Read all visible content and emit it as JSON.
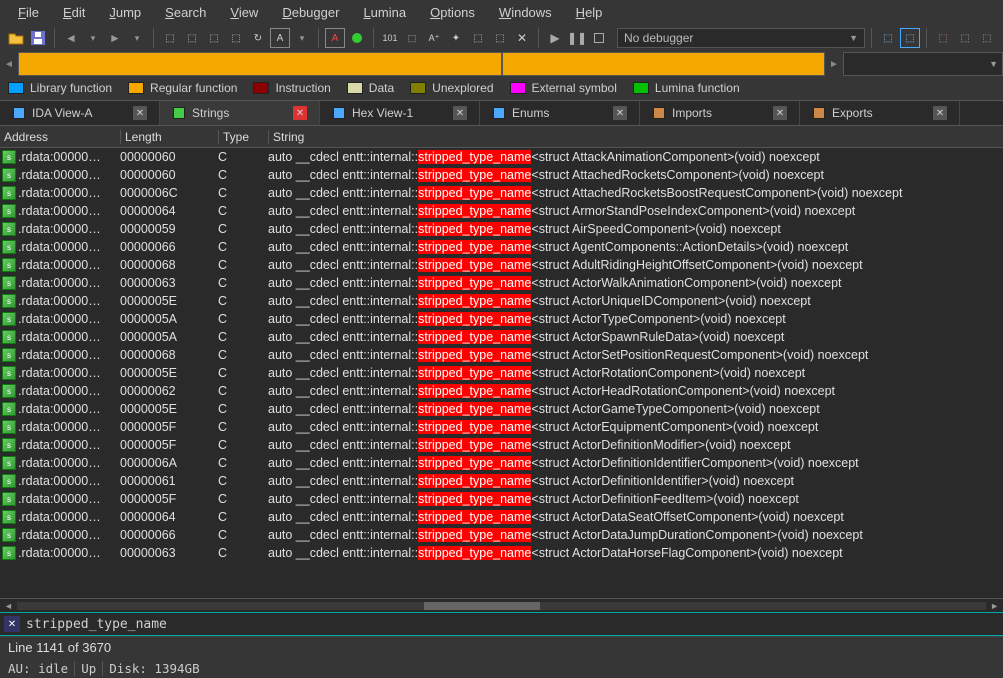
{
  "menu": [
    "File",
    "Edit",
    "Jump",
    "Search",
    "View",
    "Debugger",
    "Lumina",
    "Options",
    "Windows",
    "Help"
  ],
  "debugger_text": "No debugger",
  "legend": [
    {
      "color": "#00a0ff",
      "label": "Library function"
    },
    {
      "color": "#f4a800",
      "label": "Regular function"
    },
    {
      "color": "#8b0000",
      "label": "Instruction"
    },
    {
      "color": "#d8d8a8",
      "label": "Data"
    },
    {
      "color": "#808000",
      "label": "Unexplored"
    },
    {
      "color": "#ff00ff",
      "label": "External symbol"
    },
    {
      "color": "#00c000",
      "label": "Lumina function"
    }
  ],
  "tabs": [
    {
      "icon": "view",
      "label": "IDA View-A",
      "active": false,
      "closeRed": false
    },
    {
      "icon": "strings",
      "label": "Strings",
      "active": true,
      "closeRed": true
    },
    {
      "icon": "hex",
      "label": "Hex View-1",
      "active": false,
      "closeRed": false
    },
    {
      "icon": "enums",
      "label": "Enums",
      "active": false,
      "closeRed": false
    },
    {
      "icon": "imports",
      "label": "Imports",
      "active": false,
      "closeRed": false
    },
    {
      "icon": "exports",
      "label": "Exports",
      "active": false,
      "closeRed": false
    }
  ],
  "columns": {
    "addr": "Address",
    "len": "Length",
    "type": "Type",
    "str": "String"
  },
  "string_prefix": "auto __cdecl entt::internal::",
  "string_highlight": "stripped_type_name",
  "rows": [
    {
      "addr": ".rdata:00000…",
      "len": "00000060",
      "type": "C",
      "suffix": "<struct AttackAnimationComponent>(void) noexcept"
    },
    {
      "addr": ".rdata:00000…",
      "len": "00000060",
      "type": "C",
      "suffix": "<struct AttachedRocketsComponent>(void) noexcept"
    },
    {
      "addr": ".rdata:00000…",
      "len": "0000006C",
      "type": "C",
      "suffix": "<struct AttachedRocketsBoostRequestComponent>(void) noexcept"
    },
    {
      "addr": ".rdata:00000…",
      "len": "00000064",
      "type": "C",
      "suffix": "<struct ArmorStandPoseIndexComponent>(void) noexcept"
    },
    {
      "addr": ".rdata:00000…",
      "len": "00000059",
      "type": "C",
      "suffix": "<struct AirSpeedComponent>(void) noexcept"
    },
    {
      "addr": ".rdata:00000…",
      "len": "00000066",
      "type": "C",
      "suffix": "<struct AgentComponents::ActionDetails>(void) noexcept"
    },
    {
      "addr": ".rdata:00000…",
      "len": "00000068",
      "type": "C",
      "suffix": "<struct AdultRidingHeightOffsetComponent>(void) noexcept"
    },
    {
      "addr": ".rdata:00000…",
      "len": "00000063",
      "type": "C",
      "suffix": "<struct ActorWalkAnimationComponent>(void) noexcept"
    },
    {
      "addr": ".rdata:00000…",
      "len": "0000005E",
      "type": "C",
      "suffix": "<struct ActorUniqueIDComponent>(void) noexcept"
    },
    {
      "addr": ".rdata:00000…",
      "len": "0000005A",
      "type": "C",
      "suffix": "<struct ActorTypeComponent>(void) noexcept"
    },
    {
      "addr": ".rdata:00000…",
      "len": "0000005A",
      "type": "C",
      "suffix": "<struct ActorSpawnRuleData>(void) noexcept"
    },
    {
      "addr": ".rdata:00000…",
      "len": "00000068",
      "type": "C",
      "suffix": "<struct ActorSetPositionRequestComponent>(void) noexcept"
    },
    {
      "addr": ".rdata:00000…",
      "len": "0000005E",
      "type": "C",
      "suffix": "<struct ActorRotationComponent>(void) noexcept"
    },
    {
      "addr": ".rdata:00000…",
      "len": "00000062",
      "type": "C",
      "suffix": "<struct ActorHeadRotationComponent>(void) noexcept"
    },
    {
      "addr": ".rdata:00000…",
      "len": "0000005E",
      "type": "C",
      "suffix": "<struct ActorGameTypeComponent>(void) noexcept"
    },
    {
      "addr": ".rdata:00000…",
      "len": "0000005F",
      "type": "C",
      "suffix": "<struct ActorEquipmentComponent>(void) noexcept"
    },
    {
      "addr": ".rdata:00000…",
      "len": "0000005F",
      "type": "C",
      "suffix": "<struct ActorDefinitionModifier>(void) noexcept"
    },
    {
      "addr": ".rdata:00000…",
      "len": "0000006A",
      "type": "C",
      "suffix": "<struct ActorDefinitionIdentifierComponent>(void) noexcept"
    },
    {
      "addr": ".rdata:00000…",
      "len": "00000061",
      "type": "C",
      "suffix": "<struct ActorDefinitionIdentifier>(void) noexcept"
    },
    {
      "addr": ".rdata:00000…",
      "len": "0000005F",
      "type": "C",
      "suffix": "<struct ActorDefinitionFeedItem>(void) noexcept"
    },
    {
      "addr": ".rdata:00000…",
      "len": "00000064",
      "type": "C",
      "suffix": "<struct ActorDataSeatOffsetComponent>(void) noexcept"
    },
    {
      "addr": ".rdata:00000…",
      "len": "00000066",
      "type": "C",
      "suffix": "<struct ActorDataJumpDurationComponent>(void) noexcept"
    },
    {
      "addr": ".rdata:00000…",
      "len": "00000063",
      "type": "C",
      "suffix": "<struct ActorDataHorseFlagComponent>(void) noexcept"
    }
  ],
  "search_value": "stripped_type_name",
  "status_line": "Line 1141 of 3670",
  "status2": {
    "au": "AU:  idle",
    "up": "Up",
    "disk": "Disk: 1394GB"
  }
}
